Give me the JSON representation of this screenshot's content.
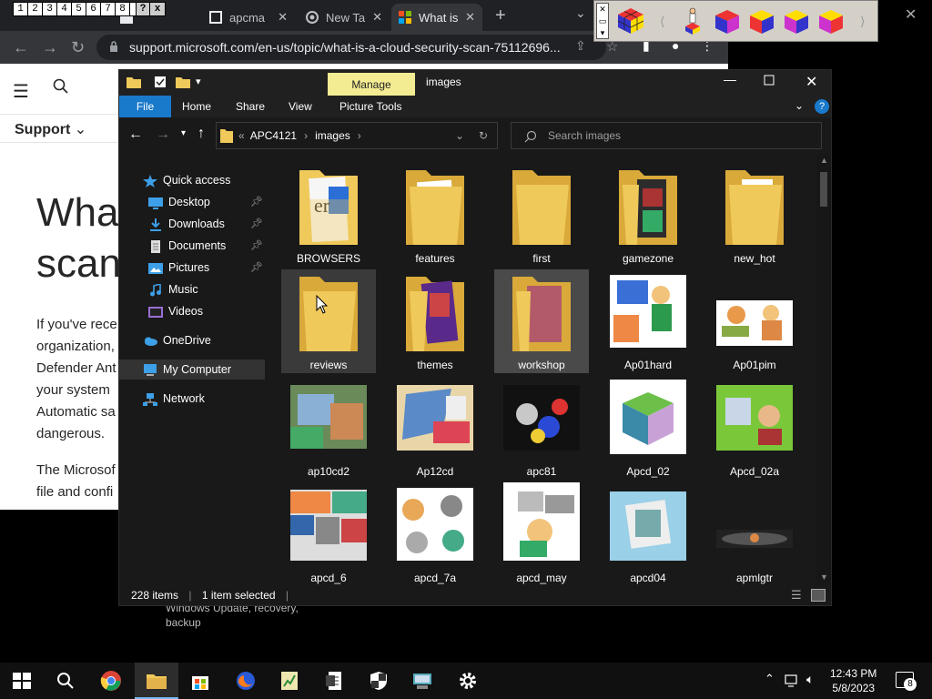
{
  "chrome": {
    "tabs": [
      {
        "label": "apcma"
      },
      {
        "label": "New Ta"
      },
      {
        "label": "What is"
      }
    ],
    "url": "support.microsoft.com/en-us/topic/what-is-a-cloud-security-scan-75112696..."
  },
  "number_toolbar": [
    "1",
    "2",
    "3",
    "4",
    "5",
    "6",
    "7",
    "8",
    "?",
    "x"
  ],
  "ms_page": {
    "support_label": "Support",
    "title_lines": [
      "What",
      "scan"
    ],
    "body_lines": [
      "If you've rece",
      "organization,",
      "Defender Ant",
      "your system",
      "Automatic sa",
      "dangerous."
    ],
    "body_lines_2": [
      "The Microsof",
      "file and confi"
    ],
    "below_text": [
      "Windows Update, recovery,",
      "backup"
    ]
  },
  "explorer": {
    "title": "images",
    "manage_label": "Manage",
    "ribbon_tabs": [
      "File",
      "Home",
      "Share",
      "View",
      "Picture Tools"
    ],
    "breadcrumb": [
      "APC4121",
      "images"
    ],
    "search_placeholder": "Search images",
    "nav": [
      {
        "label": "Quick access",
        "icon": "star-icon"
      },
      {
        "label": "Desktop",
        "icon": "desktop-icon",
        "pinned": true
      },
      {
        "label": "Downloads",
        "icon": "downloads-icon",
        "pinned": true
      },
      {
        "label": "Documents",
        "icon": "documents-icon",
        "pinned": true
      },
      {
        "label": "Pictures",
        "icon": "pictures-icon",
        "pinned": true
      },
      {
        "label": "Music",
        "icon": "music-icon"
      },
      {
        "label": "Videos",
        "icon": "videos-icon"
      },
      {
        "label": "OneDrive",
        "icon": "cloud-icon"
      },
      {
        "label": "My Computer",
        "icon": "computer-icon",
        "selected": true
      },
      {
        "label": "Network",
        "icon": "network-icon"
      }
    ],
    "items": [
      {
        "label": "BROWSERS",
        "kind": "folder"
      },
      {
        "label": "features",
        "kind": "folder"
      },
      {
        "label": "first",
        "kind": "folder"
      },
      {
        "label": "gamezone",
        "kind": "folder"
      },
      {
        "label": "new_hot",
        "kind": "folder"
      },
      {
        "label": "reviews",
        "kind": "folder",
        "state": "hover"
      },
      {
        "label": "themes",
        "kind": "folder"
      },
      {
        "label": "workshop",
        "kind": "folder",
        "state": "selected"
      },
      {
        "label": "Ap01hard",
        "kind": "image"
      },
      {
        "label": "Ap01pim",
        "kind": "image"
      },
      {
        "label": "ap10cd2",
        "kind": "image"
      },
      {
        "label": "Ap12cd",
        "kind": "image"
      },
      {
        "label": "apc81",
        "kind": "image"
      },
      {
        "label": "Apcd_02",
        "kind": "image"
      },
      {
        "label": "Apcd_02a",
        "kind": "image"
      },
      {
        "label": "apcd_6",
        "kind": "image"
      },
      {
        "label": "apcd_7a",
        "kind": "image"
      },
      {
        "label": "apcd_may",
        "kind": "image"
      },
      {
        "label": "apcd04",
        "kind": "image"
      },
      {
        "label": "apmlgtr",
        "kind": "image"
      }
    ],
    "status": {
      "count": "228 items",
      "selected": "1 item selected"
    }
  },
  "taskbar": {
    "time": "12:43 PM",
    "date": "5/8/2023",
    "notifications": "8"
  }
}
